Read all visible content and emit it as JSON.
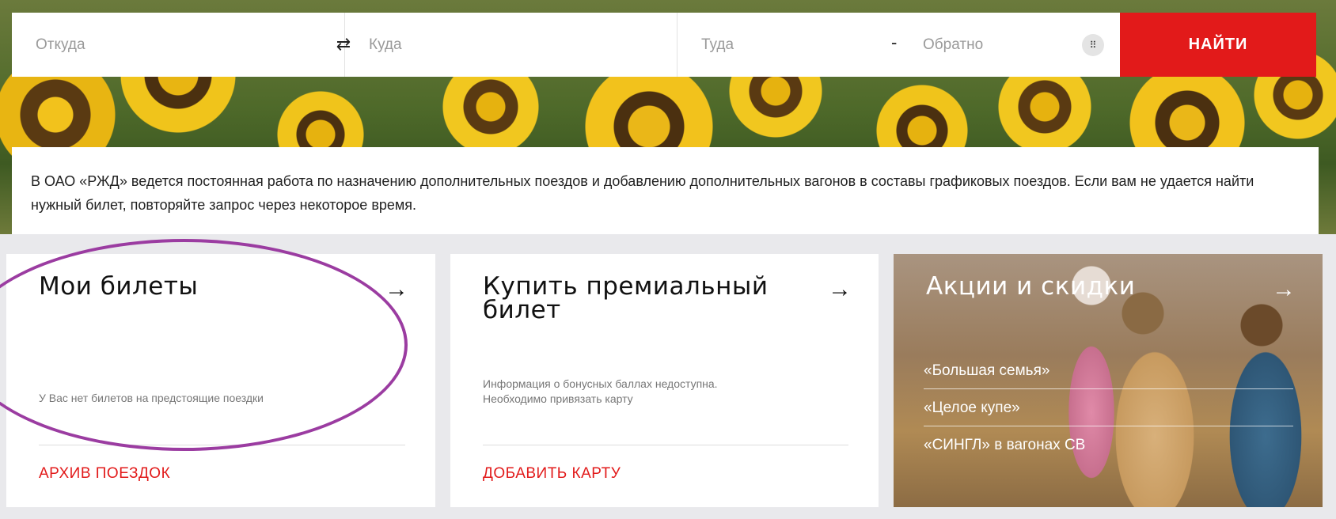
{
  "search": {
    "from_placeholder": "Откуда",
    "to_placeholder": "Куда",
    "there_placeholder": "Туда",
    "back_placeholder": "Обратно",
    "dash": "-",
    "find_label": "НАЙТИ",
    "swap_icon": "⇄",
    "calendar_icon": "⠿"
  },
  "notice": {
    "text": "В ОАО «РЖД» ведется постоянная работа по назначению дополнительных поездов и добавлению дополнительных вагонов в составы графиковых поездов. Если вам не удается найти нужный билет, повторяйте запрос через некоторое время."
  },
  "cards": {
    "my_tickets": {
      "title": "Мои билеты",
      "arrow": "→",
      "empty_text": "У Вас нет билетов на предстоящие поездки",
      "link": "АРХИВ ПОЕЗДОК"
    },
    "premium": {
      "title": "Купить премиальный билет",
      "arrow": "→",
      "info_line1": "Информация о бонусных баллах недоступна.",
      "info_line2": "Необходимо привязать карту",
      "link": "ДОБАВИТЬ КАРТУ"
    },
    "promos": {
      "title": "Акции и скидки",
      "arrow": "→",
      "items": [
        "«Большая семья»",
        "«Целое купе»",
        "«СИНГЛ» в вагонах СВ"
      ]
    }
  },
  "colors": {
    "accent": "#e21a1a",
    "annotation": "#9b3ca1"
  }
}
